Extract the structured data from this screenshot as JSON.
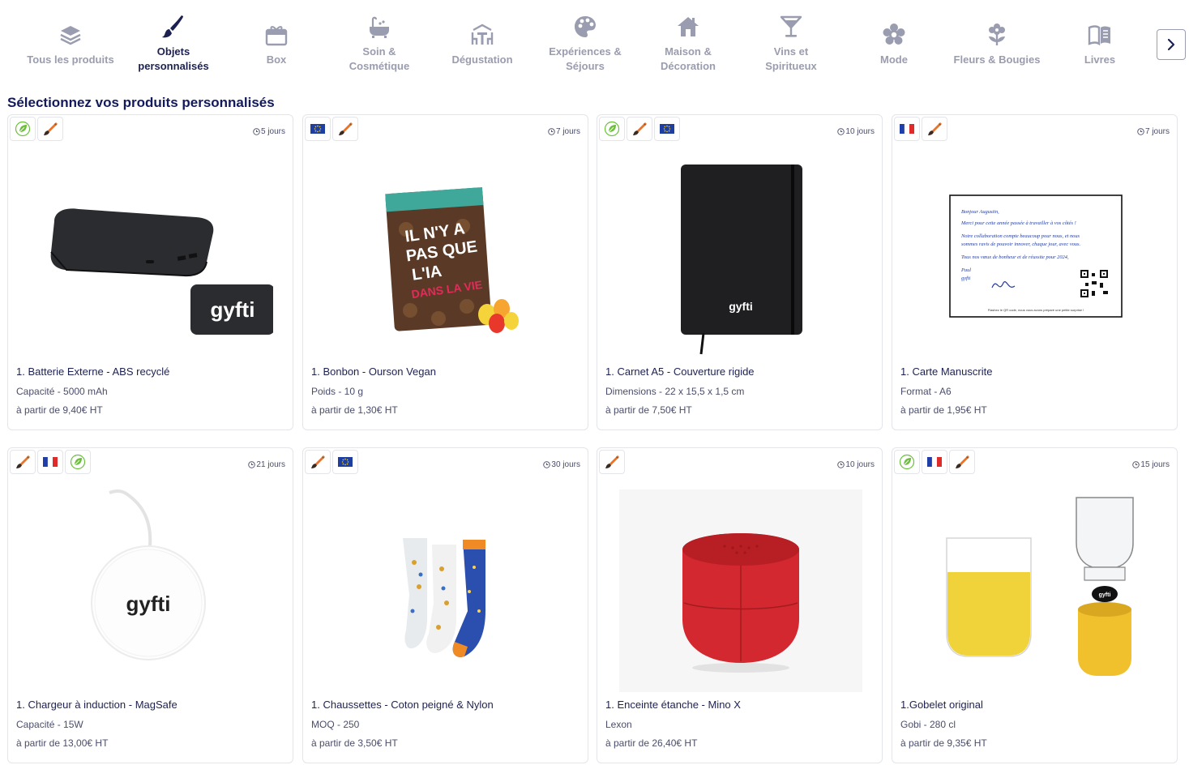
{
  "categories": [
    {
      "label": "Tous les produits",
      "icon": "layers-icon",
      "active": false
    },
    {
      "label": "Objets\npersonnalisés",
      "icon": "paintbrush-icon",
      "active": true
    },
    {
      "label": "Box",
      "icon": "gift-box-icon",
      "active": false
    },
    {
      "label": "Soin &\nCosmétique",
      "icon": "bathtub-icon",
      "active": false
    },
    {
      "label": "Dégustation",
      "icon": "table-chairs-icon",
      "active": false
    },
    {
      "label": "Expériences &\nSéjours",
      "icon": "palette-icon",
      "active": false
    },
    {
      "label": "Maison &\nDécoration",
      "icon": "house-icon",
      "active": false
    },
    {
      "label": "Vins et\nSpiritueux",
      "icon": "cocktail-glass-icon",
      "active": false
    },
    {
      "label": "Mode",
      "icon": "flower-gear-icon",
      "active": false
    },
    {
      "label": "Fleurs & Bougies",
      "icon": "flower-icon",
      "active": false
    },
    {
      "label": "Livres",
      "icon": "book-icon",
      "active": false
    }
  ],
  "next_arrow_icon": "chevron-right-icon",
  "section_title": "Sélectionnez vos produits personnalisés",
  "colors": {
    "navy": "#1d2151",
    "muted": "#9a9caf",
    "eco_green": "#6bbf3a",
    "brush_orange": "#e8742c",
    "eu_blue": "#1e3fa0"
  },
  "products": [
    {
      "badges": [
        "eco",
        "brush"
      ],
      "delay": "5 jours",
      "name": "1. Batterie Externe - ABS recyclé",
      "spec": "Capacité - 5000 mAh",
      "price": "à partir de 9,40€ HT",
      "image": "powerbank"
    },
    {
      "badges": [
        "eu",
        "brush"
      ],
      "delay": "7 jours",
      "name": "1. Bonbon - Ourson Vegan",
      "spec": "Poids - 10 g",
      "price": "à partir de 1,30€ HT",
      "image": "candy"
    },
    {
      "badges": [
        "eco",
        "brush",
        "eu"
      ],
      "delay": "10 jours",
      "name": "1. Carnet A5 - Couverture rigide",
      "spec": "Dimensions - 22 x 15,5 x 1,5 cm",
      "price": "à partir de 7,50€ HT",
      "image": "notebook"
    },
    {
      "badges": [
        "fr",
        "brush"
      ],
      "delay": "7 jours",
      "name": "1. Carte Manuscrite",
      "spec": "Format - A6",
      "price": "à partir de 1,95€ HT",
      "image": "card"
    },
    {
      "badges": [
        "brush",
        "fr",
        "eco"
      ],
      "delay": "21 jours",
      "name": "1. Chargeur à induction - MagSafe",
      "spec": "Capacité - 15W",
      "price": "à partir de 13,00€ HT",
      "image": "charger"
    },
    {
      "badges": [
        "brush",
        "eu"
      ],
      "delay": "30 jours",
      "name": "1. Chaussettes - Coton peigné & Nylon",
      "spec": "MOQ - 250",
      "price": "à partir de 3,50€ HT",
      "image": "socks"
    },
    {
      "badges": [
        "brush"
      ],
      "delay": "10 jours",
      "name": "1. Enceinte étanche - Mino X",
      "spec": "Lexon",
      "price": "à partir de 26,40€ HT",
      "image": "speaker"
    },
    {
      "badges": [
        "eco",
        "fr",
        "brush"
      ],
      "delay": "15 jours",
      "name": "1.Gobelet original",
      "spec": "Gobi  - 280 cl",
      "price": "à partir de 9,35€ HT",
      "image": "cups"
    }
  ],
  "image_text": {
    "powerbank": "gyfti",
    "candy": "IL N'Y A PAS QUE L'IA DANS LA VIE",
    "notebook": "gyfti",
    "card_lines": [
      "Bonjour Augustin,",
      "Merci pour cette année passée à travailler à vos côtés !",
      "Notre collaboration compte beaucoup pour nous, et nous",
      "sommes ravis de pouvoir innover, chaque jour, avec vous.",
      "Tous nos vœux de bonheur et de réussite pour 2024,",
      "Paul",
      "gyfti"
    ],
    "card_footer": "Flashez le QR code, nous vous avons préparé une petite surprise !",
    "charger": "gyfti",
    "cups": "gyfti"
  }
}
